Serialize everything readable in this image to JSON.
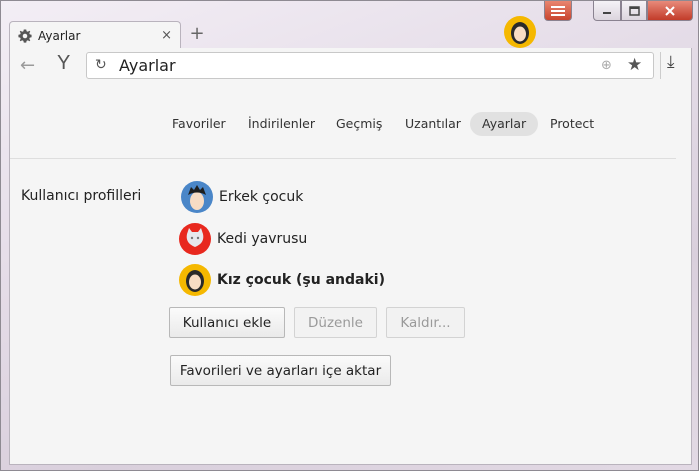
{
  "tab": {
    "title": "Ayarlar",
    "close": "×",
    "new_tab": "+"
  },
  "toolbar": {
    "back": "←",
    "logo": "Y",
    "reload": "↻",
    "url": "Ayarlar",
    "globe": "⊕",
    "star": "★",
    "download": "⤓"
  },
  "nav": {
    "items": [
      {
        "label": "Favoriler"
      },
      {
        "label": "İndirilenler"
      },
      {
        "label": "Geçmiş"
      },
      {
        "label": "Uzantılar"
      },
      {
        "label": "Ayarlar",
        "active": true
      },
      {
        "label": "Protect"
      }
    ]
  },
  "profiles": {
    "section_label": "Kullanıcı profilleri",
    "items": [
      {
        "name": "Erkek çocuk",
        "avatar": "boy-avatar-icon",
        "current": false
      },
      {
        "name": "Kedi yavrusu",
        "avatar": "cat-avatar-icon",
        "current": false
      },
      {
        "name": "Kız çocuk (şu andaki)",
        "avatar": "girl-avatar-icon",
        "current": true
      }
    ],
    "buttons": {
      "add": "Kullanıcı ekle",
      "edit": "Düzenle",
      "remove": "Kaldır...",
      "import": "Favorileri ve ayarları içe aktar"
    }
  },
  "colors": {
    "accent": "#f5b800",
    "window_close": "#c23c2a",
    "boy_avatar_bg": "#4a86c8",
    "cat_avatar_bg": "#e8281e"
  }
}
